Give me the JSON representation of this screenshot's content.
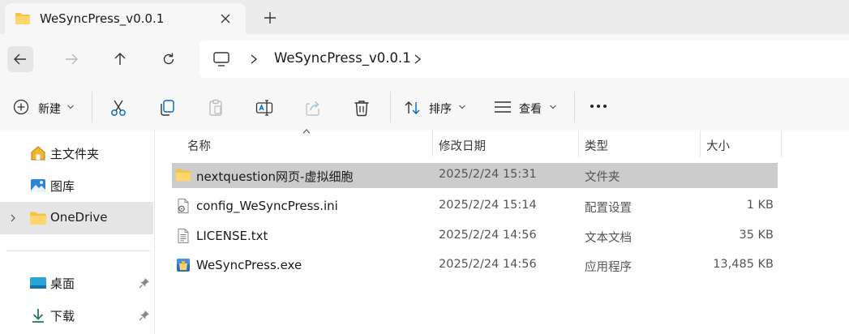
{
  "tab": {
    "title": "WeSyncPress_v0.0.1"
  },
  "address": {
    "crumb": "WeSyncPress_v0.0.1"
  },
  "toolbar": {
    "new_label": "新建",
    "sort_label": "排序",
    "view_label": "查看",
    "icons": [
      "cut-icon",
      "copy-icon",
      "paste-icon",
      "rename-icon",
      "share-icon",
      "delete-icon",
      "more-icon"
    ]
  },
  "nav": {
    "items": [
      {
        "label": "主文件夹",
        "icon": "home-icon"
      },
      {
        "label": "图库",
        "icon": "gallery-icon"
      },
      {
        "label": "OneDrive",
        "icon": "folder-icon"
      },
      {
        "label": "桌面",
        "icon": "desktop-icon"
      },
      {
        "label": "下载",
        "icon": "download-icon"
      }
    ]
  },
  "columns": {
    "name": "名称",
    "modified": "修改日期",
    "type": "类型",
    "size": "大小"
  },
  "files": [
    {
      "name": "nextquestion网页-虚拟细胞",
      "modified": "2025/2/24 15:31",
      "type": "文件夹",
      "size": "",
      "icon": "folder-icon"
    },
    {
      "name": "config_WeSyncPress.ini",
      "modified": "2025/2/24 15:14",
      "type": "配置设置",
      "size": "1 KB",
      "icon": "settings-file-icon"
    },
    {
      "name": "LICENSE.txt",
      "modified": "2025/2/24 14:56",
      "type": "文本文档",
      "size": "35 KB",
      "icon": "text-file-icon"
    },
    {
      "name": "WeSyncPress.exe",
      "modified": "2025/2/24 14:56",
      "type": "应用程序",
      "size": "13,485 KB",
      "icon": "exe-icon"
    }
  ],
  "colors": {
    "folder": "#f5c542",
    "selected_row": "#cccccc",
    "accent": "#0067c0"
  }
}
